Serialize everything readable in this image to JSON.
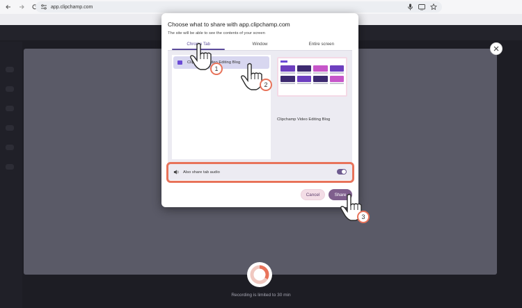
{
  "browser": {
    "url": "app.clipchamp.com",
    "back_icon": "arrow-left-icon",
    "forward_icon": "arrow-right-icon",
    "reload_icon": "reload-icon",
    "site_info_icon": "site-info-icon",
    "mic_icon": "microphone-icon",
    "cast_icon": "cast-icon",
    "bookmark_icon": "star-icon"
  },
  "dialog": {
    "title": "Choose what to share with app.clipchamp.com",
    "subtitle": "The site will be able to see the contents of your screen",
    "tabs": [
      {
        "label": "Chrome Tab",
        "active": true
      },
      {
        "label": "Window",
        "active": false
      },
      {
        "label": "Entire screen",
        "active": false
      }
    ],
    "tab_list": [
      {
        "label": "Clipchamp Video Editing Blog",
        "selected": true
      }
    ],
    "preview_label": "Clipchamp Video Editing Blog",
    "audio": {
      "label": "Also share tab audio",
      "enabled": true
    },
    "cancel_label": "Cancel",
    "share_label": "Share"
  },
  "background": {
    "recording_note": "Recording is limited to 30 min"
  },
  "annotations": {
    "steps": [
      "1",
      "2",
      "3"
    ],
    "highlight_color": "#e8735a"
  },
  "colors": {
    "accent": "#5b4a9a",
    "share_button": "#7f5f8d",
    "cancel_button": "#f3dde6"
  }
}
